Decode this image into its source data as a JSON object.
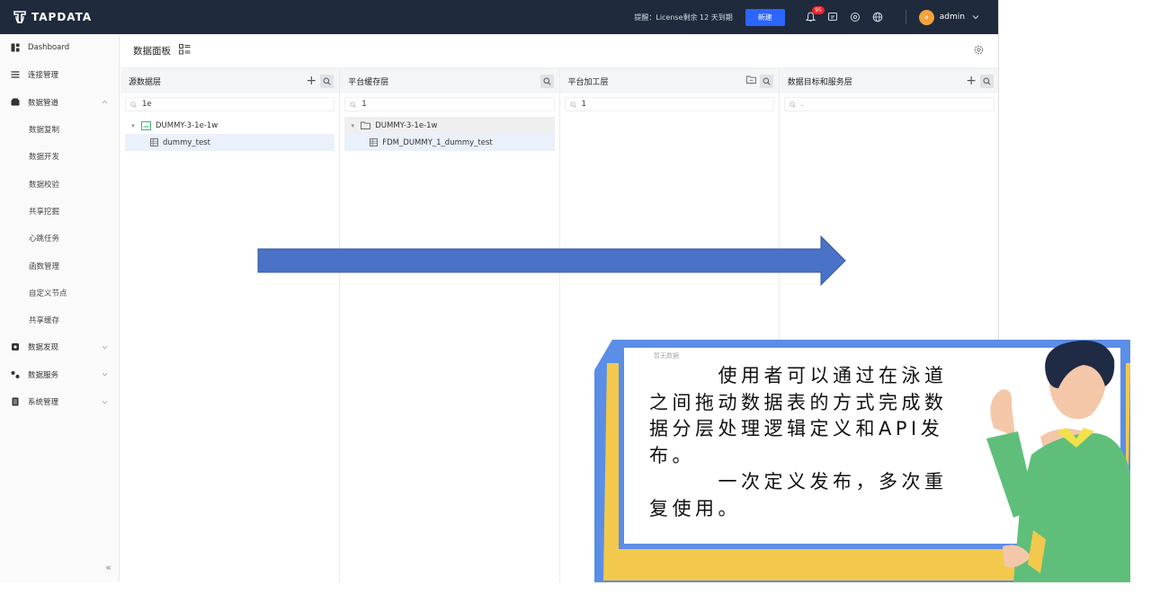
{
  "brand": {
    "name": "TAPDATA"
  },
  "topbar": {
    "notice": "提醒：License剩余 12 天到期",
    "new_button": "新建",
    "notification_count": "95",
    "user": "admin",
    "avatar_initial": "a"
  },
  "sidebar": {
    "items": [
      {
        "label": "Dashboard",
        "icon": "dashboard-icon"
      },
      {
        "label": "连接管理",
        "icon": "list-icon"
      },
      {
        "label": "数据管道",
        "icon": "pipeline-icon",
        "caret": "^"
      },
      {
        "label": "数据复制",
        "sub": true
      },
      {
        "label": "数据开发",
        "sub": true
      },
      {
        "label": "数据校验",
        "sub": true
      },
      {
        "label": "共享挖掘",
        "sub": true
      },
      {
        "label": "心跳任务",
        "sub": true
      },
      {
        "label": "函数管理",
        "sub": true
      },
      {
        "label": "自定义节点",
        "sub": true
      },
      {
        "label": "共享缓存",
        "sub": true
      },
      {
        "label": "数据发现",
        "icon": "discovery-icon",
        "caret": "v"
      },
      {
        "label": "数据服务",
        "icon": "service-icon",
        "caret": "v"
      },
      {
        "label": "系统管理",
        "icon": "system-icon",
        "caret": "v"
      }
    ],
    "collapse_glyph": "«"
  },
  "main": {
    "title": "数据面板"
  },
  "lanes": [
    {
      "title": "源数据层",
      "search_value": "1e",
      "search_placeholder": "",
      "tree": [
        {
          "caret": "▾",
          "label": "DUMMY-3-1e-1w",
          "type": "connection"
        },
        {
          "label": "dummy_test",
          "type": "table",
          "child": true,
          "highlight": true
        }
      ]
    },
    {
      "title": "平台缓存层",
      "search_value": "1",
      "search_placeholder": "",
      "tree": [
        {
          "caret": "▾",
          "label": "DUMMY-3-1e-1w",
          "type": "folder"
        },
        {
          "label": "FDM_DUMMY_1_dummy_test",
          "type": "table",
          "child": true,
          "highlight": true
        }
      ]
    },
    {
      "title": "平台加工层",
      "search_value": "1",
      "search_placeholder": "",
      "tree": []
    },
    {
      "title": "数据目标和服务层",
      "search_value": "",
      "search_placeholder": ".",
      "tree": []
    }
  ],
  "empty_text": "暂无数据",
  "callout": {
    "line1": "使用者可以通过在泳道之间拖动数据表的方式完成数据分层处理逻辑定义和API发布。",
    "line2": "一次定义发布，多次重复使用。"
  },
  "colors": {
    "topbar": "#1f2a3c",
    "accent": "#2c65ff",
    "arrow": "#4a72c6",
    "frame_blue": "#5b8ee6",
    "frame_yellow": "#f2c94c"
  }
}
